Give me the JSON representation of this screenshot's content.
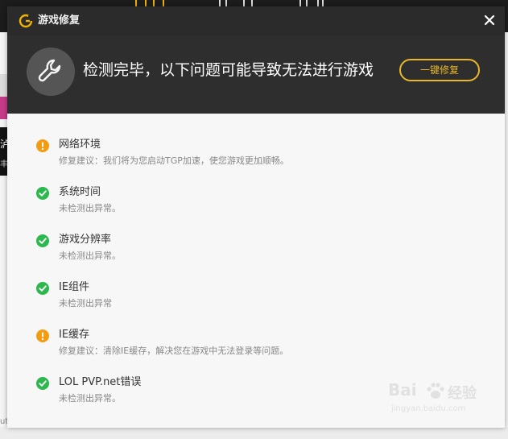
{
  "dialog": {
    "title": "游戏修复",
    "close_symbol": "✕"
  },
  "header": {
    "message": "检测完毕，以下问题可能导致无法进行游戏",
    "repair_button": "一键修复",
    "icon": "wrench-icon"
  },
  "issues": [
    {
      "name": "网络环境",
      "desc": "修复建议：我们将为您启动TGP加速，使您游戏更加顺畅。",
      "status": "warning"
    },
    {
      "name": "系统时间",
      "desc": "未检测出异常。",
      "status": "ok"
    },
    {
      "name": "游戏分辨率",
      "desc": "未检测出异常。",
      "status": "ok"
    },
    {
      "name": "IE组件",
      "desc": "未检测出异常",
      "status": "ok"
    },
    {
      "name": "IE缓存",
      "desc": "修复建议：清除IE缓存，解决您在游戏中无法登录等问题。",
      "status": "warning"
    },
    {
      "name": "LOL PVP.net错误",
      "desc": "未检测出异常。",
      "status": "ok"
    }
  ],
  "background": {
    "side_glyph_1": "泸",
    "side_glyph_2": "丰",
    "side_glyph_3": "ut"
  },
  "watermark": {
    "brand_left": "Bai",
    "brand_right": "经验",
    "url": "jingyan.baidu.com"
  },
  "colors": {
    "accent": "#e8b829",
    "ok": "#2db84d",
    "warning": "#f39c12",
    "header_bg": "#2e2e2e",
    "titlebar_bg": "#2b2b2b"
  }
}
